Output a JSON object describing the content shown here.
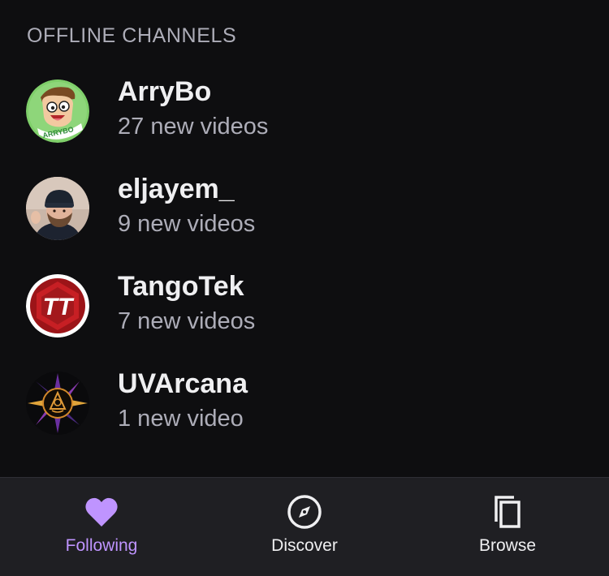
{
  "section": {
    "title": "OFFLINE CHANNELS"
  },
  "channels": [
    {
      "name": "ArryBo",
      "subtitle": "27 new videos",
      "avatar_icon": "arrybo-avatar"
    },
    {
      "name": "eljayem_",
      "subtitle": "9 new videos",
      "avatar_icon": "eljayem-avatar"
    },
    {
      "name": "TangoTek",
      "subtitle": "7 new videos",
      "avatar_icon": "tangotek-avatar",
      "avatar_logo_text": "TT"
    },
    {
      "name": "UVArcana",
      "subtitle": "1 new video",
      "avatar_icon": "uvarcana-avatar"
    }
  ],
  "tab_bar": {
    "tabs": [
      {
        "label": "Following",
        "icon": "heart-icon",
        "active": true
      },
      {
        "label": "Discover",
        "icon": "compass-icon",
        "active": false
      },
      {
        "label": "Browse",
        "icon": "copy-icon",
        "active": false
      }
    ],
    "active_color": "#bf94ff",
    "inactive_color": "#efeff1"
  },
  "colors": {
    "background": "#0e0e10",
    "tab_bar_background": "#1f1f23",
    "primary_text": "#efeff1",
    "secondary_text": "#adadb8"
  }
}
